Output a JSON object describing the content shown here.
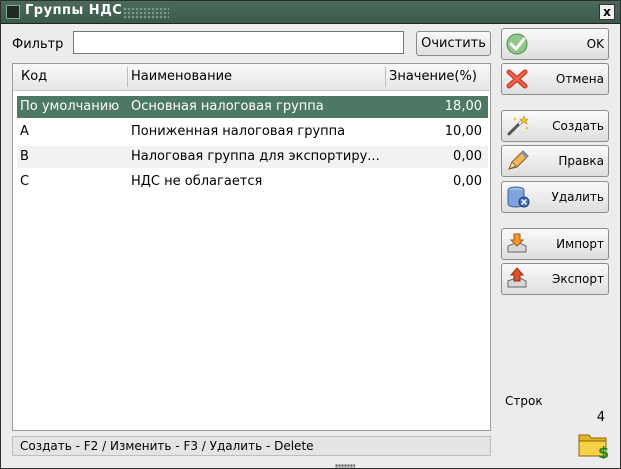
{
  "window": {
    "title": "Группы НДС",
    "close_label": "x"
  },
  "filter": {
    "label": "Фильтр",
    "value": "",
    "clear_label": "Очистить"
  },
  "table": {
    "columns": [
      "Код",
      "Наименование",
      "Значение(%)"
    ],
    "rows": [
      {
        "code": "По умолчанию",
        "name": "Основная налоговая группа",
        "value": "18,00"
      },
      {
        "code": "A",
        "name": "Пониженная налоговая группа",
        "value": "10,00"
      },
      {
        "code": "B",
        "name": "Налоговая группа для экспортиру...",
        "value": "0,00"
      },
      {
        "code": "C",
        "name": "НДС не облагается",
        "value": "0,00"
      }
    ],
    "selected_row": 0
  },
  "status": {
    "text": "Создать - F2 / Изменить - F3 / Удалить - Delete"
  },
  "sidebar": {
    "ok_label": "OK",
    "cancel_label": "Отмена",
    "create_label": "Создать",
    "edit_label": "Правка",
    "delete_label": "Удалить",
    "import_label": "Импорт",
    "export_label": "Экспорт",
    "rows_label": "Строк",
    "rows_count": "4"
  },
  "colors": {
    "titlebar": "#3f5f50",
    "selection": "#4d7864"
  }
}
